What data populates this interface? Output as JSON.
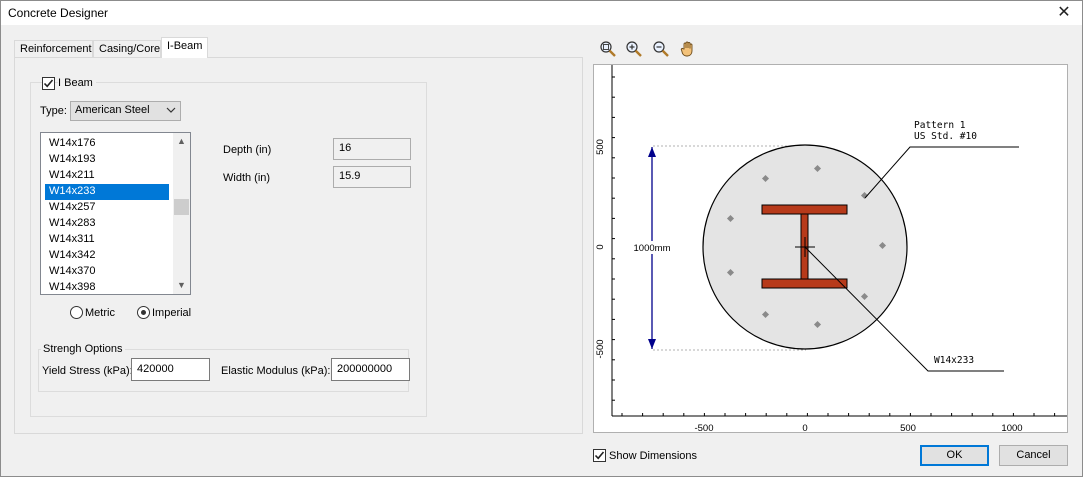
{
  "window": {
    "title": "Concrete Designer",
    "close_glyph": "✕"
  },
  "tabs": [
    {
      "label": "Reinforcement"
    },
    {
      "label": "Casing/Core"
    },
    {
      "label": "I-Beam"
    }
  ],
  "ibeam": {
    "enabled_label": "I Beam",
    "enabled": true,
    "type_label": "Type:",
    "type_value": "American Steel",
    "sections": [
      "W14x176",
      "W14x193",
      "W14x211",
      "W14x233",
      "W14x257",
      "W14x283",
      "W14x311",
      "W14x342",
      "W14x370",
      "W14x398"
    ],
    "selected_section": "W14x233",
    "units": {
      "metric_label": "Metric",
      "imperial_label": "Imperial",
      "selected": "Imperial"
    },
    "depth_label": "Depth (in)",
    "depth_value": "16",
    "width_label": "Width (in)",
    "width_value": "15.9"
  },
  "strength": {
    "group_label": "Strengh Options",
    "yield_label": "Yield Stress (kPa):",
    "yield_value": "420000",
    "modulus_label": "Elastic Modulus (kPa):",
    "modulus_value": "200000000"
  },
  "toolbar": {
    "icons": [
      "zoom-extents-icon",
      "zoom-in-icon",
      "zoom-out-icon",
      "pan-hand-icon"
    ]
  },
  "plot": {
    "x_ticks": [
      "-500",
      "0",
      "500",
      "1000"
    ],
    "y_ticks": [
      "500",
      "0",
      "-500"
    ],
    "dimension_label": "1000mm",
    "pattern_label_1": "Pattern 1",
    "pattern_label_2": "US Std. #10",
    "beam_label": "W14x233",
    "colors": {
      "section_fill": "#e4e4e4",
      "steel_fill": "#b73a1a",
      "dimension": "#00008b"
    }
  },
  "show_dimensions": {
    "label": "Show Dimensions",
    "checked": true
  },
  "buttons": {
    "ok": "OK",
    "cancel": "Cancel"
  }
}
